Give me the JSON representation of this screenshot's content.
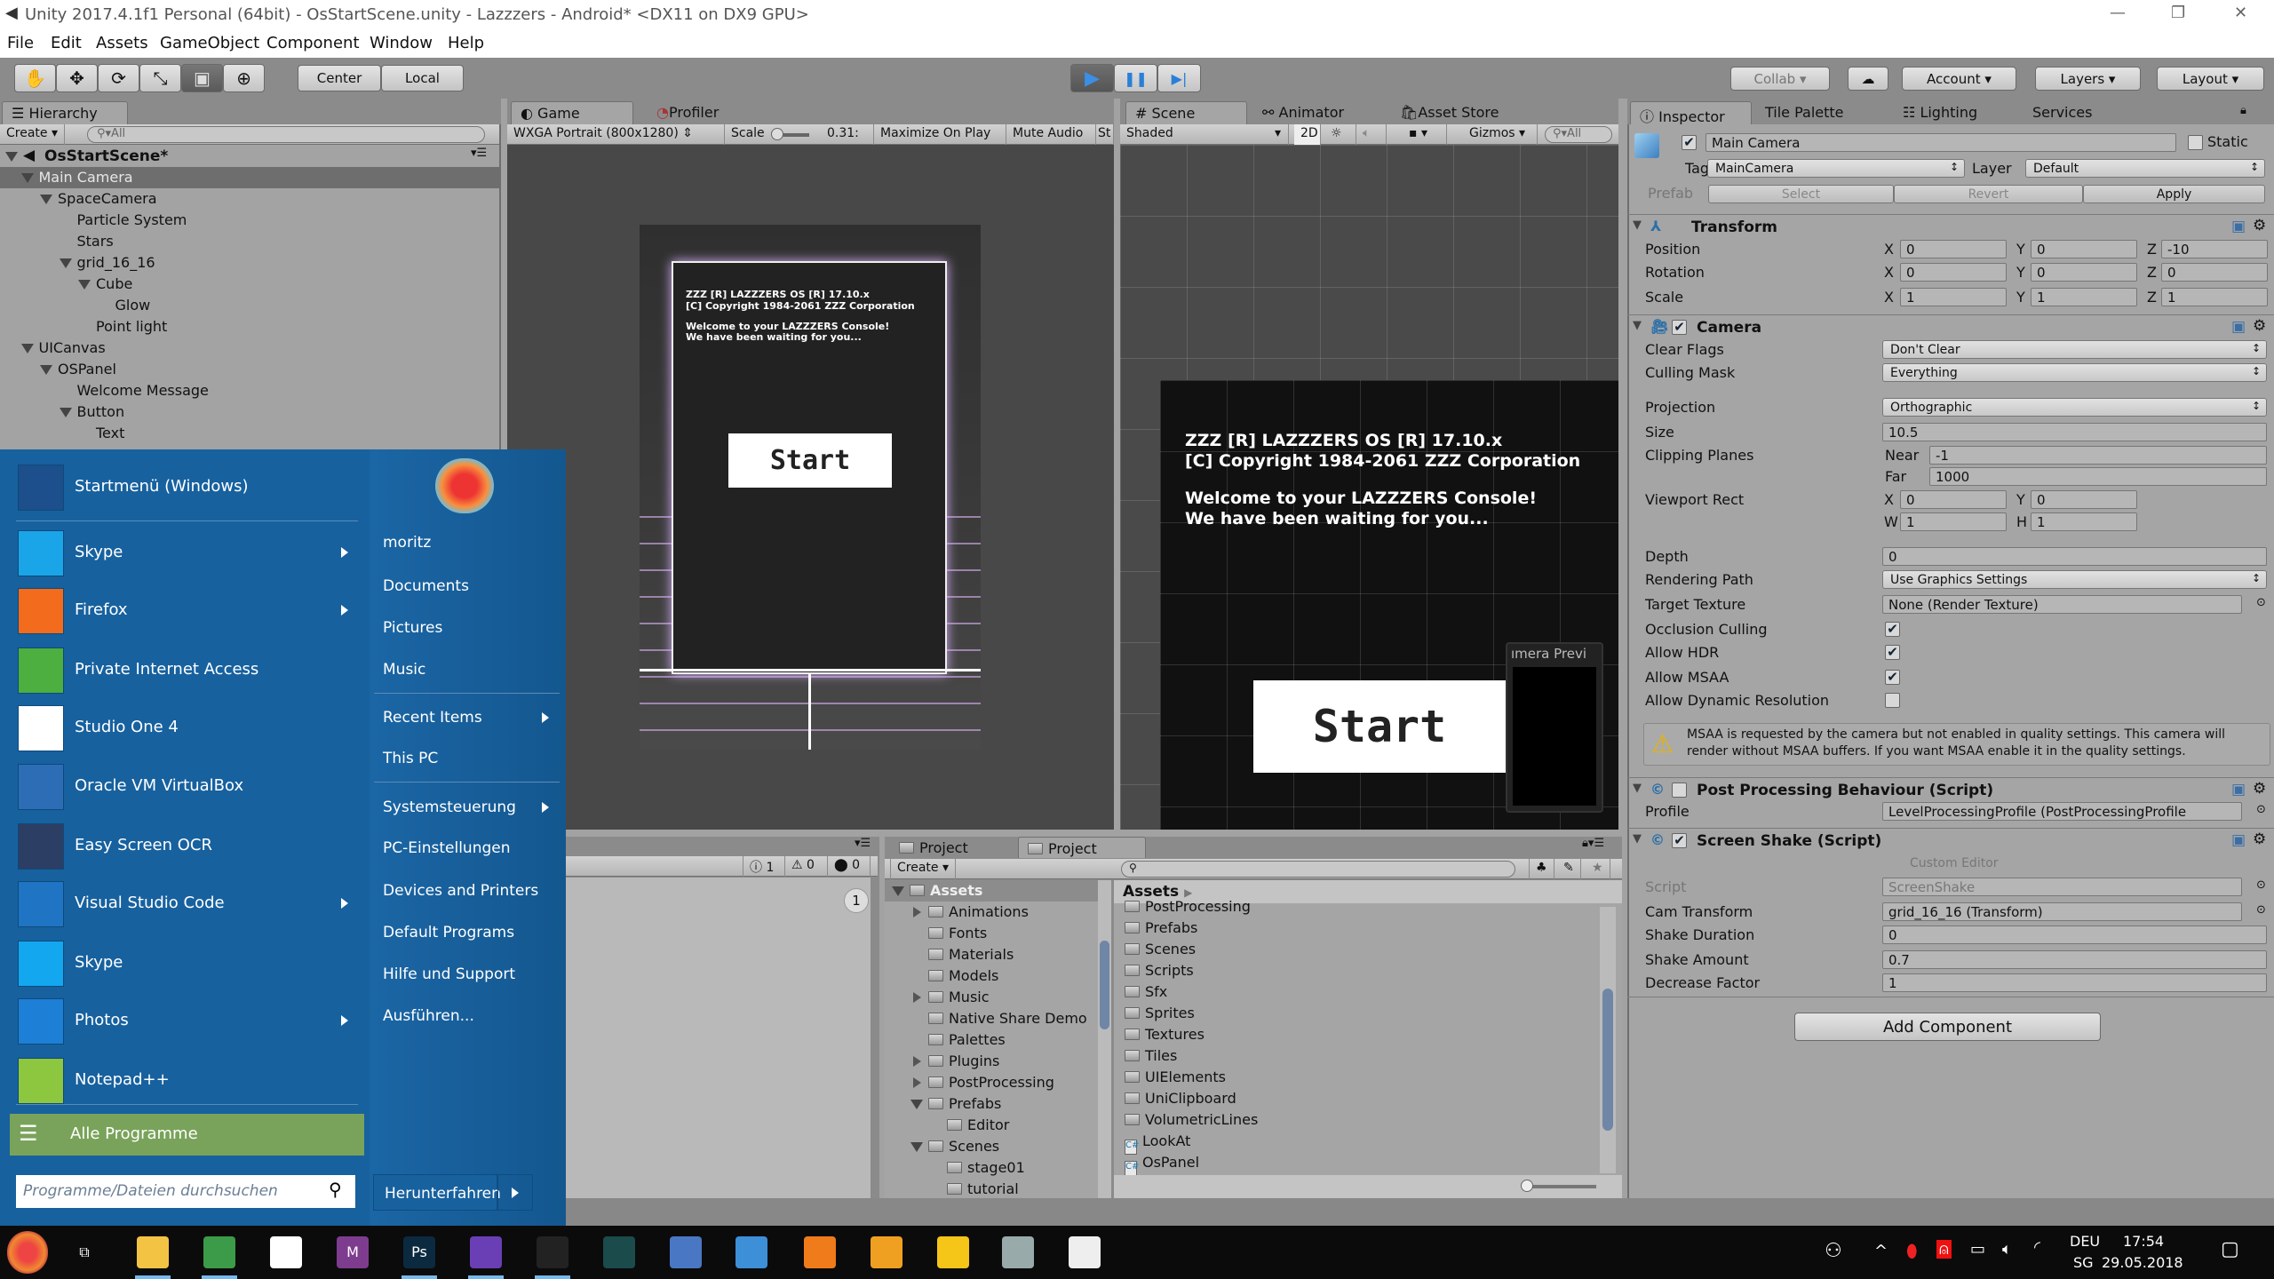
{
  "window": {
    "title": "Unity 2017.4.1f1 Personal (64bit) - OsStartScene.unity - Lazzzers - Android* <DX11 on DX9 GPU>",
    "minimize": "—",
    "restore": "❐",
    "close": "✕"
  },
  "menu": [
    "File",
    "Edit",
    "Assets",
    "GameObject",
    "Component",
    "Window",
    "Help"
  ],
  "toolbar": {
    "tools": [
      {
        "icon": "hand-icon",
        "glyph": "✋"
      },
      {
        "icon": "move-icon",
        "glyph": "✥"
      },
      {
        "icon": "rotate-icon",
        "glyph": "⟳"
      },
      {
        "icon": "scale-icon",
        "glyph": "⤡"
      },
      {
        "icon": "rect-tool-icon",
        "glyph": "▣"
      },
      {
        "icon": "transform-tool-icon",
        "glyph": "⊕"
      }
    ],
    "active_tool": 4,
    "pivot": "Center",
    "space": "Local",
    "play": "▶",
    "pause": "❚❚",
    "step": "▶|",
    "collab": "Collab ▾",
    "cloud": "☁",
    "account": "Account",
    "layers": "Layers",
    "layout": "Layout",
    "accent": "#3b8fe6"
  },
  "hierarchy": {
    "tab": "Hierarchy",
    "create": "Create",
    "search": "All",
    "scene": "OsStartScene*",
    "items": [
      {
        "label": "Main Camera",
        "depth": 1,
        "arrow": true,
        "selected": true
      },
      {
        "label": "SpaceCamera",
        "depth": 2,
        "arrow": true
      },
      {
        "label": "Particle System",
        "depth": 3
      },
      {
        "label": "Stars",
        "depth": 3
      },
      {
        "label": "grid_16_16",
        "depth": 3,
        "arrow": true
      },
      {
        "label": "Cube",
        "depth": 4,
        "arrow": true
      },
      {
        "label": "Glow",
        "depth": 5
      },
      {
        "label": "Point light",
        "depth": 4
      },
      {
        "label": "UICanvas",
        "depth": 1,
        "arrow": true
      },
      {
        "label": "OSPanel",
        "depth": 2,
        "arrow": true
      },
      {
        "label": "Welcome Message",
        "depth": 3
      },
      {
        "label": "Button",
        "depth": 3,
        "arrow": true
      },
      {
        "label": "Text",
        "depth": 4
      }
    ]
  },
  "game": {
    "tabs": [
      "Game",
      "Profiler"
    ],
    "resolution": "WXGA Portrait (800x1280)",
    "scale_label": "Scale",
    "scale_value": "0.31:",
    "maximize": "Maximize On Play",
    "mute": "Mute Audio",
    "stats": "St",
    "console_lines": [
      "ZZZ [R] LAZZZERS OS [R] 17.10.x",
      "[C] Copyright 1984-2061 ZZZ Corporation",
      "Welcome to your LAZZZERS Console!",
      "We have been waiting for you..."
    ],
    "start": "Start"
  },
  "scene": {
    "tabs": [
      "Scene",
      "Animator",
      "Asset Store"
    ],
    "shading": "Shaded",
    "mode_2d": "2D",
    "gizmos": "Gizmos",
    "search": "All",
    "camera_preview": "ımera Previ"
  },
  "inspector": {
    "tabs": [
      "Inspector",
      "Tile Palette",
      "Lighting",
      "Services"
    ],
    "object": {
      "name": "Main Camera",
      "active": true,
      "static_label": "Static",
      "tag_label": "Tag",
      "tag": "MainCamera",
      "layer_label": "Layer",
      "layer": "Default",
      "prefab_label": "Prefab",
      "select": "Select",
      "revert": "Revert",
      "apply": "Apply"
    },
    "transform": {
      "title": "Transform",
      "rows": [
        {
          "label": "Position",
          "x": "0",
          "y": "0",
          "z": "-10"
        },
        {
          "label": "Rotation",
          "x": "0",
          "y": "0",
          "z": "0"
        },
        {
          "label": "Scale",
          "x": "1",
          "y": "1",
          "z": "1"
        }
      ]
    },
    "camera": {
      "title": "Camera",
      "enabled": true,
      "rows": [
        {
          "label": "Clear Flags",
          "type": "dropdown",
          "value": "Don't Clear"
        },
        {
          "label": "Culling Mask",
          "type": "dropdown",
          "value": "Everything"
        },
        {
          "label": "Projection",
          "type": "dropdown",
          "value": "Orthographic"
        },
        {
          "label": "Size",
          "type": "field",
          "value": "10.5"
        },
        {
          "label": "Clipping Planes",
          "type": "clip",
          "near_label": "Near",
          "near": "-1",
          "far_label": "Far",
          "far": "1000"
        },
        {
          "label": "Viewport Rect",
          "type": "rect",
          "x": "0",
          "y": "0",
          "w": "1",
          "h": "1"
        },
        {
          "label": "Depth",
          "type": "field",
          "value": "0"
        },
        {
          "label": "Rendering Path",
          "type": "dropdown",
          "value": "Use Graphics Settings"
        },
        {
          "label": "Target Texture",
          "type": "object",
          "value": "None (Render Texture)"
        },
        {
          "label": "Occlusion Culling",
          "type": "check",
          "value": true
        },
        {
          "label": "Allow HDR",
          "type": "check",
          "value": true
        },
        {
          "label": "Allow MSAA",
          "type": "check",
          "value": true
        },
        {
          "label": "Allow Dynamic Resolution",
          "type": "check",
          "value": false
        }
      ]
    },
    "warning": "MSAA is requested by the camera but not enabled in quality settings. This camera will render without MSAA buffers. If you want MSAA enable it in the quality settings.",
    "post_processing": {
      "title": "Post Processing Behaviour (Script)",
      "enabled": false,
      "profile_label": "Profile",
      "profile": "LevelProcessingProfile (PostProcessingProfile"
    },
    "screen_shake": {
      "title": "Screen Shake (Script)",
      "enabled": true,
      "custom_editor": "Custom Editor",
      "rows": [
        {
          "label": "Script",
          "type": "object",
          "value": "ScreenShake",
          "disabled": true
        },
        {
          "label": "Cam Transform",
          "type": "object",
          "value": "grid_16_16 (Transform)"
        },
        {
          "label": "Shake Duration",
          "type": "field",
          "value": "0"
        },
        {
          "label": "Shake Amount",
          "type": "field",
          "value": "0.7"
        },
        {
          "label": "Decrease Factor",
          "type": "field",
          "value": "1"
        }
      ]
    },
    "add_component": "Add Component"
  },
  "console": {
    "info": "1",
    "warn": "0",
    "error": "0",
    "collapse_count": "1"
  },
  "project": {
    "tabs": [
      "Project",
      "Project"
    ],
    "create": "Create",
    "breadcrumb": "Assets",
    "tree": [
      {
        "label": "Assets",
        "depth": 0,
        "open": true,
        "selected": true
      },
      {
        "label": "Animations",
        "depth": 1,
        "collapsed": true
      },
      {
        "label": "Fonts",
        "depth": 1
      },
      {
        "label": "Materials",
        "depth": 1
      },
      {
        "label": "Models",
        "depth": 1
      },
      {
        "label": "Music",
        "depth": 1,
        "collapsed": true
      },
      {
        "label": "Native Share Demo",
        "depth": 1
      },
      {
        "label": "Palettes",
        "depth": 1
      },
      {
        "label": "Plugins",
        "depth": 1,
        "collapsed": true
      },
      {
        "label": "PostProcessing",
        "depth": 1,
        "collapsed": true
      },
      {
        "label": "Prefabs",
        "depth": 1,
        "open": true
      },
      {
        "label": "Editor",
        "depth": 2
      },
      {
        "label": "Scenes",
        "depth": 1,
        "open": true
      },
      {
        "label": "stage01",
        "depth": 2
      },
      {
        "label": "tutorial",
        "depth": 2
      }
    ],
    "items": [
      {
        "label": "PostProcessing",
        "kind": "folder"
      },
      {
        "label": "Prefabs",
        "kind": "folder"
      },
      {
        "label": "Scenes",
        "kind": "folder"
      },
      {
        "label": "Scripts",
        "kind": "folder"
      },
      {
        "label": "Sfx",
        "kind": "folder"
      },
      {
        "label": "Sprites",
        "kind": "folder"
      },
      {
        "label": "Textures",
        "kind": "folder"
      },
      {
        "label": "Tiles",
        "kind": "folder"
      },
      {
        "label": "UIElements",
        "kind": "folder"
      },
      {
        "label": "UniClipboard",
        "kind": "folder"
      },
      {
        "label": "VolumetricLines",
        "kind": "folder"
      },
      {
        "label": "LookAt",
        "kind": "script"
      },
      {
        "label": "OsPanel",
        "kind": "script"
      }
    ]
  },
  "start_menu": {
    "color": "#17619f",
    "apps": [
      {
        "label": "Startmenü (Windows)",
        "icon": "start-menu-icon",
        "color": "#1d4f8c",
        "sub": false
      },
      {
        "label": "Skype",
        "icon": "skype-icon",
        "color": "#1aa5e8",
        "sub": true
      },
      {
        "label": "Firefox",
        "icon": "firefox-icon",
        "color": "#f36b1c",
        "sub": true
      },
      {
        "label": "Private Internet Access",
        "icon": "pia-icon",
        "color": "#4caf3f",
        "sub": false
      },
      {
        "label": "Studio One 4",
        "icon": "studio-one-icon",
        "color": "#ffffff",
        "sub": false
      },
      {
        "label": "Oracle VM VirtualBox",
        "icon": "virtualbox-icon",
        "color": "#2d6db5",
        "sub": false
      },
      {
        "label": "Easy Screen OCR",
        "icon": "ocr-icon",
        "color": "#2c3e63",
        "sub": false
      },
      {
        "label": "Visual Studio Code",
        "icon": "vscode-icon",
        "color": "#1f74c4",
        "sub": true
      },
      {
        "label": "Skype",
        "icon": "skype-icon",
        "color": "#12a7ef",
        "sub": false
      },
      {
        "label": "Photos",
        "icon": "photos-icon",
        "color": "#1d7fd6",
        "sub": true
      },
      {
        "label": "Notepad++",
        "icon": "notepadpp-icon",
        "color": "#8dc63f",
        "sub": false
      }
    ],
    "all_programs": "Alle Programme",
    "all_programs_color": "#79a35a",
    "search_placeholder": "Programme/Dateien durchsuchen",
    "user": "moritz",
    "places": [
      {
        "label": "Documents"
      },
      {
        "label": "Pictures"
      },
      {
        "label": "Music"
      },
      {
        "label": "Recent Items",
        "sub": true
      },
      {
        "label": "This PC"
      },
      {
        "label": "Systemsteuerung",
        "sub": true
      },
      {
        "label": "PC-Einstellungen"
      },
      {
        "label": "Devices and Printers"
      },
      {
        "label": "Default Programs"
      },
      {
        "label": "Hilfe und Support"
      },
      {
        "label": "Ausführen..."
      }
    ],
    "shutdown": "Herunterfahren"
  },
  "taskbar": {
    "icons": [
      {
        "name": "task-view-icon",
        "color": "#0b0b0b",
        "glyph": "⧉"
      },
      {
        "name": "file-explorer-icon",
        "color": "#f3c443",
        "active": true
      },
      {
        "name": "chrome-icon",
        "color": "#3c9b48",
        "active": true
      },
      {
        "name": "store-icon",
        "color": "#ffffff"
      },
      {
        "name": "adobe-muse-icon",
        "color": "#7e3c8f",
        "glyph": "M"
      },
      {
        "name": "photoshop-icon",
        "color": "#0b2a3f",
        "glyph": "Ps",
        "active": true
      },
      {
        "name": "visual-studio-icon",
        "color": "#6a3fb5",
        "active": true
      },
      {
        "name": "unity-icon",
        "color": "#222222",
        "active": true
      },
      {
        "name": "gitkraken-icon",
        "color": "#1b4b4b"
      },
      {
        "name": "remote-desktop-icon",
        "color": "#4a77c4"
      },
      {
        "name": "translator-icon",
        "color": "#3d8fd8"
      },
      {
        "name": "blender-icon",
        "color": "#f07b1a"
      },
      {
        "name": "fl-studio-icon",
        "color": "#f0a020"
      },
      {
        "name": "inkscape-icon",
        "color": "#f5c518"
      },
      {
        "name": "tool-icon",
        "color": "#9aa"
      },
      {
        "name": "presentation-icon",
        "color": "#eeeeee"
      }
    ],
    "lang": "DEU",
    "region": "SG",
    "time": "17:54",
    "date": "29.05.2018"
  }
}
